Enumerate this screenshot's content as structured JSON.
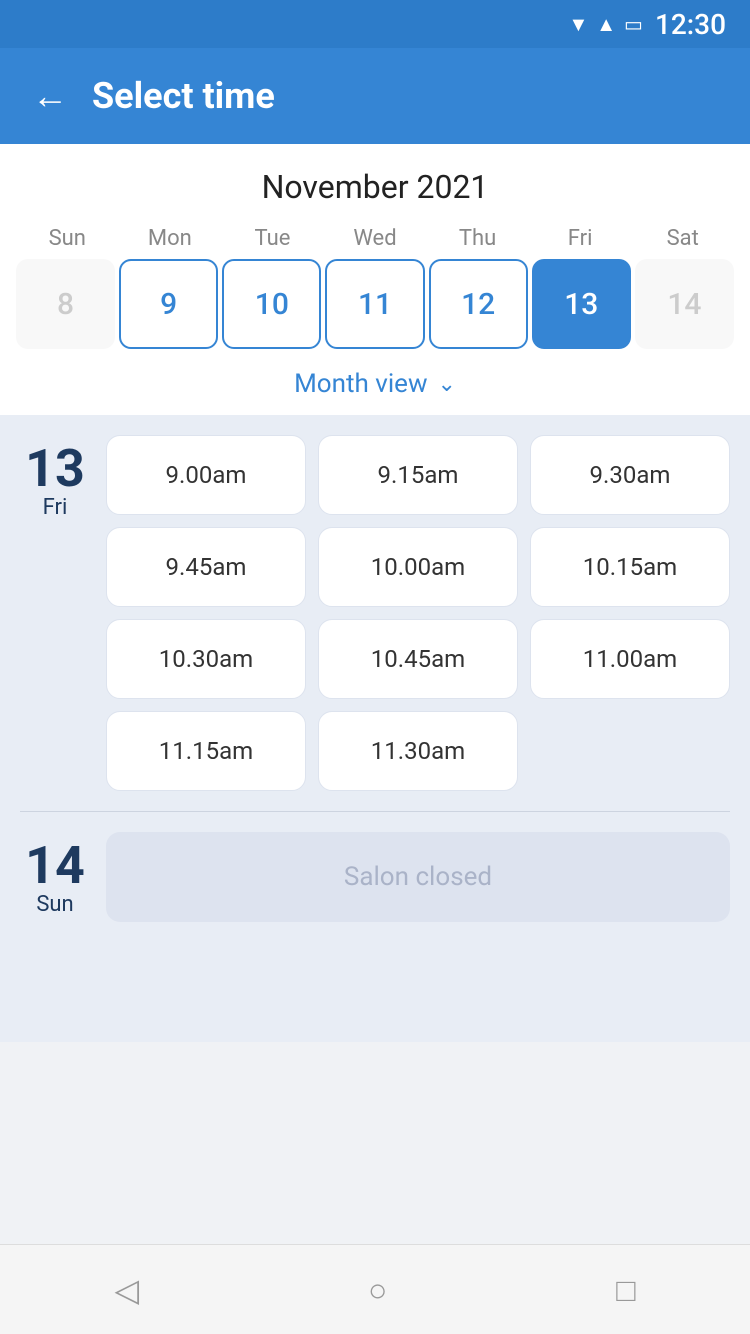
{
  "statusBar": {
    "time": "12:30"
  },
  "header": {
    "title": "Select time",
    "backLabel": "←"
  },
  "calendar": {
    "monthYear": "November 2021",
    "weekdays": [
      "Sun",
      "Mon",
      "Tue",
      "Wed",
      "Thu",
      "Fri",
      "Sat"
    ],
    "days": [
      {
        "num": "8",
        "state": "inactive"
      },
      {
        "num": "9",
        "state": "active"
      },
      {
        "num": "10",
        "state": "active"
      },
      {
        "num": "11",
        "state": "active"
      },
      {
        "num": "12",
        "state": "active"
      },
      {
        "num": "13",
        "state": "selected"
      },
      {
        "num": "14",
        "state": "inactive"
      }
    ],
    "monthViewLabel": "Month view"
  },
  "day13": {
    "number": "13",
    "name": "Fri",
    "slots": [
      "9.00am",
      "9.15am",
      "9.30am",
      "9.45am",
      "10.00am",
      "10.15am",
      "10.30am",
      "10.45am",
      "11.00am",
      "11.15am",
      "11.30am"
    ]
  },
  "day14": {
    "number": "14",
    "name": "Sun",
    "closedLabel": "Salon closed"
  },
  "bottomNav": {
    "back": "◁",
    "home": "○",
    "recent": "□"
  }
}
